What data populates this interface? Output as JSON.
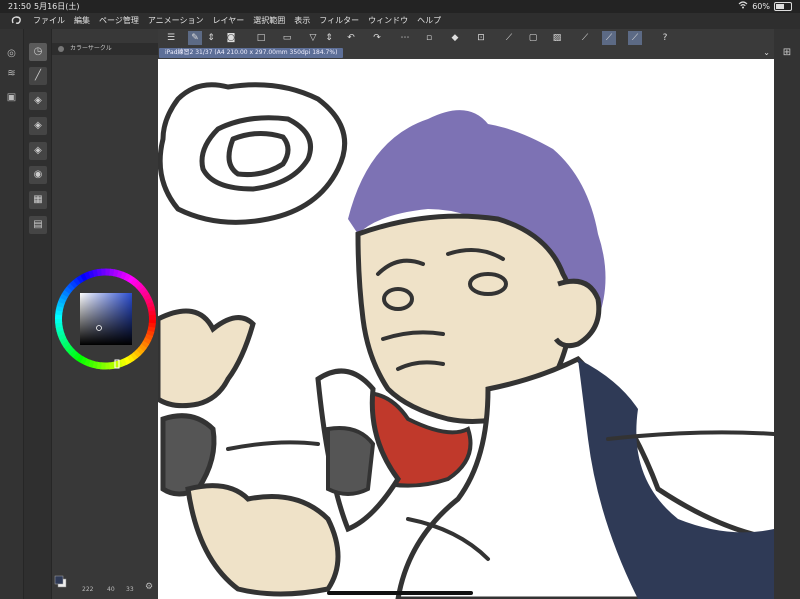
{
  "status": {
    "time": "21:50",
    "date": "5月16日(土)",
    "battery": "60%",
    "battery_level": 0.6,
    "wifi_icon": "wifi-icon"
  },
  "menu": {
    "items": [
      "ファイル",
      "編集",
      "ページ管理",
      "アニメーション",
      "レイヤー",
      "選択範囲",
      "表示",
      "フィルター",
      "ウィンドウ",
      "ヘルプ"
    ]
  },
  "palette": {
    "title": "カラーサークル",
    "stats": "222",
    "stats2": "40",
    "stats3": "33",
    "wheel_hue_degrees": 230
  },
  "document": {
    "tab_title": "iPad練習2 31/37 (A4 210.00 x 297.00mm 350dpi 184.7%)"
  },
  "colors": {
    "accent": "#5d6f98",
    "hair": "#7d72b4",
    "skin": "#efe2c8",
    "scarf": "#c0392b",
    "coat": "#2f3a56",
    "lineart": "#333333"
  }
}
